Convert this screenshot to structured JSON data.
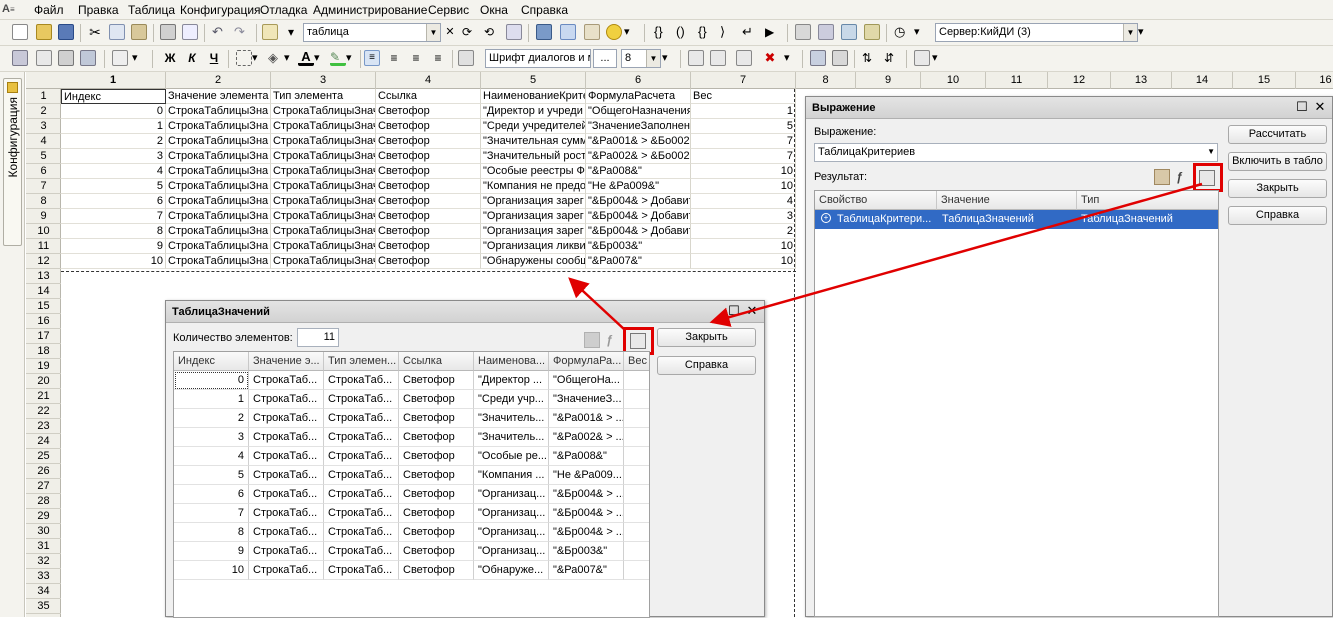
{
  "menu": {
    "items": [
      "Файл",
      "Правка",
      "Таблица",
      "Конфигурация",
      "Отладка",
      "Администрирование",
      "Сервис",
      "Окна",
      "Справка"
    ]
  },
  "toolbar1": {
    "search_value": "таблица",
    "server_value": "Сервер:КийДИ (3)"
  },
  "toolbar2": {
    "bold": "Ж",
    "italic": "К",
    "underline": "Ч",
    "font_value": "Шрифт диалогов и м",
    "font_more": "...",
    "size_value": "8"
  },
  "leftbar": {
    "config_tab": "Конфигурация"
  },
  "grid": {
    "col_headers": [
      "1",
      "2",
      "3",
      "4",
      "5",
      "6",
      "7",
      "8",
      "9",
      "10",
      "11",
      "12",
      "13",
      "14",
      "15",
      "16"
    ],
    "row_headers": [
      "1",
      "2",
      "3",
      "4",
      "5",
      "6",
      "7",
      "8",
      "9",
      "10",
      "11",
      "12",
      "13",
      "14",
      "15",
      "16",
      "17",
      "18",
      "19",
      "20",
      "21",
      "22",
      "23",
      "24",
      "25",
      "26",
      "27",
      "28",
      "29",
      "30",
      "31",
      "32",
      "33",
      "34",
      "35"
    ],
    "header_row": [
      "Индекс",
      "Значение элемента",
      "Тип элемента",
      "Ссылка",
      "НаименованиеКрите",
      "ФормулаРасчета",
      "Вес"
    ],
    "rows": [
      [
        "0",
        "СтрокаТаблицыЗна",
        "СтрокаТаблицыЗнач",
        "Светофор",
        "\"Директор и учреди",
        "\"ОбщегоНазначения",
        "1"
      ],
      [
        "1",
        "СтрокаТаблицыЗна",
        "СтрокаТаблицыЗнач",
        "Светофор",
        "\"Среди учредителей",
        "\"ЗначениеЗаполнен",
        "5"
      ],
      [
        "2",
        "СтрокаТаблицыЗна",
        "СтрокаТаблицыЗнач",
        "Светофор",
        "\"Значительная сумм",
        "\"&Ра001& > &Бо002&",
        "7"
      ],
      [
        "3",
        "СтрокаТаблицыЗна",
        "СтрокаТаблицыЗнач",
        "Светофор",
        "\"Значительный рост",
        "\"&Ра002& > &Бо002&",
        "7"
      ],
      [
        "4",
        "СтрокаТаблицыЗна",
        "СтрокаТаблицыЗнач",
        "Светофор",
        "\"Особые реестры Ф",
        "\"&Ра008&\"",
        "10"
      ],
      [
        "5",
        "СтрокаТаблицыЗна",
        "СтрокаТаблицыЗнач",
        "Светофор",
        "\"Компания не предо",
        "\"Не &Ра009&\"",
        "10"
      ],
      [
        "6",
        "СтрокаТаблицыЗна",
        "СтрокаТаблицыЗнач",
        "Светофор",
        "\"Организация зарег",
        "\"&Бр004& > Добавит",
        "4"
      ],
      [
        "7",
        "СтрокаТаблицыЗна",
        "СтрокаТаблицыЗнач",
        "Светофор",
        "\"Организация зарег",
        "\"&Бр004& > Добавит",
        "3"
      ],
      [
        "8",
        "СтрокаТаблицыЗна",
        "СтрокаТаблицыЗнач",
        "Светофор",
        "\"Организация зарег",
        "\"&Бр004& > Добавит",
        "2"
      ],
      [
        "9",
        "СтрокаТаблицыЗна",
        "СтрокаТаблицыЗнач",
        "Светофор",
        "\"Организация ликви",
        "\"&Бр003&\"",
        "10"
      ],
      [
        "10",
        "СтрокаТаблицыЗна",
        "СтрокаТаблицыЗнач",
        "Светофор",
        "\"Обнаружены сообщ",
        "\"&Ра007&\"",
        "10"
      ]
    ]
  },
  "vt_window": {
    "title": "ТаблицаЗначений",
    "count_label": "Количество элементов:",
    "count_value": "11",
    "close_button": "Закрыть",
    "help_button": "Справка",
    "columns": [
      "Индекс",
      "Значение э...",
      "Тип элемен...",
      "Ссылка",
      "Наименова...",
      "ФормулаРа...",
      "Вес"
    ],
    "rows": [
      [
        "0",
        "СтрокаТаб...",
        "СтрокаТаб...",
        "Светофор",
        "\"Директор ...",
        "\"ОбщегоНа..."
      ],
      [
        "1",
        "СтрокаТаб...",
        "СтрокаТаб...",
        "Светофор",
        "\"Среди учр...",
        "\"ЗначениеЗ..."
      ],
      [
        "2",
        "СтрокаТаб...",
        "СтрокаТаб...",
        "Светофор",
        "\"Значитель...",
        "\"&Ра001& > ..."
      ],
      [
        "3",
        "СтрокаТаб...",
        "СтрокаТаб...",
        "Светофор",
        "\"Значитель...",
        "\"&Ра002& > ..."
      ],
      [
        "4",
        "СтрокаТаб...",
        "СтрокаТаб...",
        "Светофор",
        "\"Особые ре...",
        "\"&Ра008&\""
      ],
      [
        "5",
        "СтрокаТаб...",
        "СтрокаТаб...",
        "Светофор",
        "\"Компания ...",
        "\"Не &Ра009..."
      ],
      [
        "6",
        "СтрокаТаб...",
        "СтрокаТаб...",
        "Светофор",
        "\"Организац...",
        "\"&Бр004& > ..."
      ],
      [
        "7",
        "СтрокаТаб...",
        "СтрокаТаб...",
        "Светофор",
        "\"Организац...",
        "\"&Бр004& > ..."
      ],
      [
        "8",
        "СтрокаТаб...",
        "СтрокаТаб...",
        "Светофор",
        "\"Организац...",
        "\"&Бр004& > ..."
      ],
      [
        "9",
        "СтрокаТаб...",
        "СтрокаТаб...",
        "Светофор",
        "\"Организац...",
        "\"&Бр003&\""
      ],
      [
        "10",
        "СтрокаТаб...",
        "СтрокаТаб...",
        "Светофор",
        "\"Обнаруже...",
        "\"&Ра007&\""
      ]
    ]
  },
  "expr_window": {
    "title": "Выражение",
    "expr_label": "Выражение:",
    "expr_value": "ТаблицаКритериев",
    "result_label": "Результат:",
    "calc_button": "Рассчитать",
    "include_button": "Включить в табло",
    "close_button": "Закрыть",
    "help_button": "Справка",
    "columns": [
      "Свойство",
      "Значение",
      "Тип"
    ],
    "row": [
      "ТаблицаКритери...",
      "ТаблицаЗначений",
      "ТаблицаЗначений"
    ],
    "selected_color": "#316ac5"
  },
  "annotation_color": "#e00000"
}
